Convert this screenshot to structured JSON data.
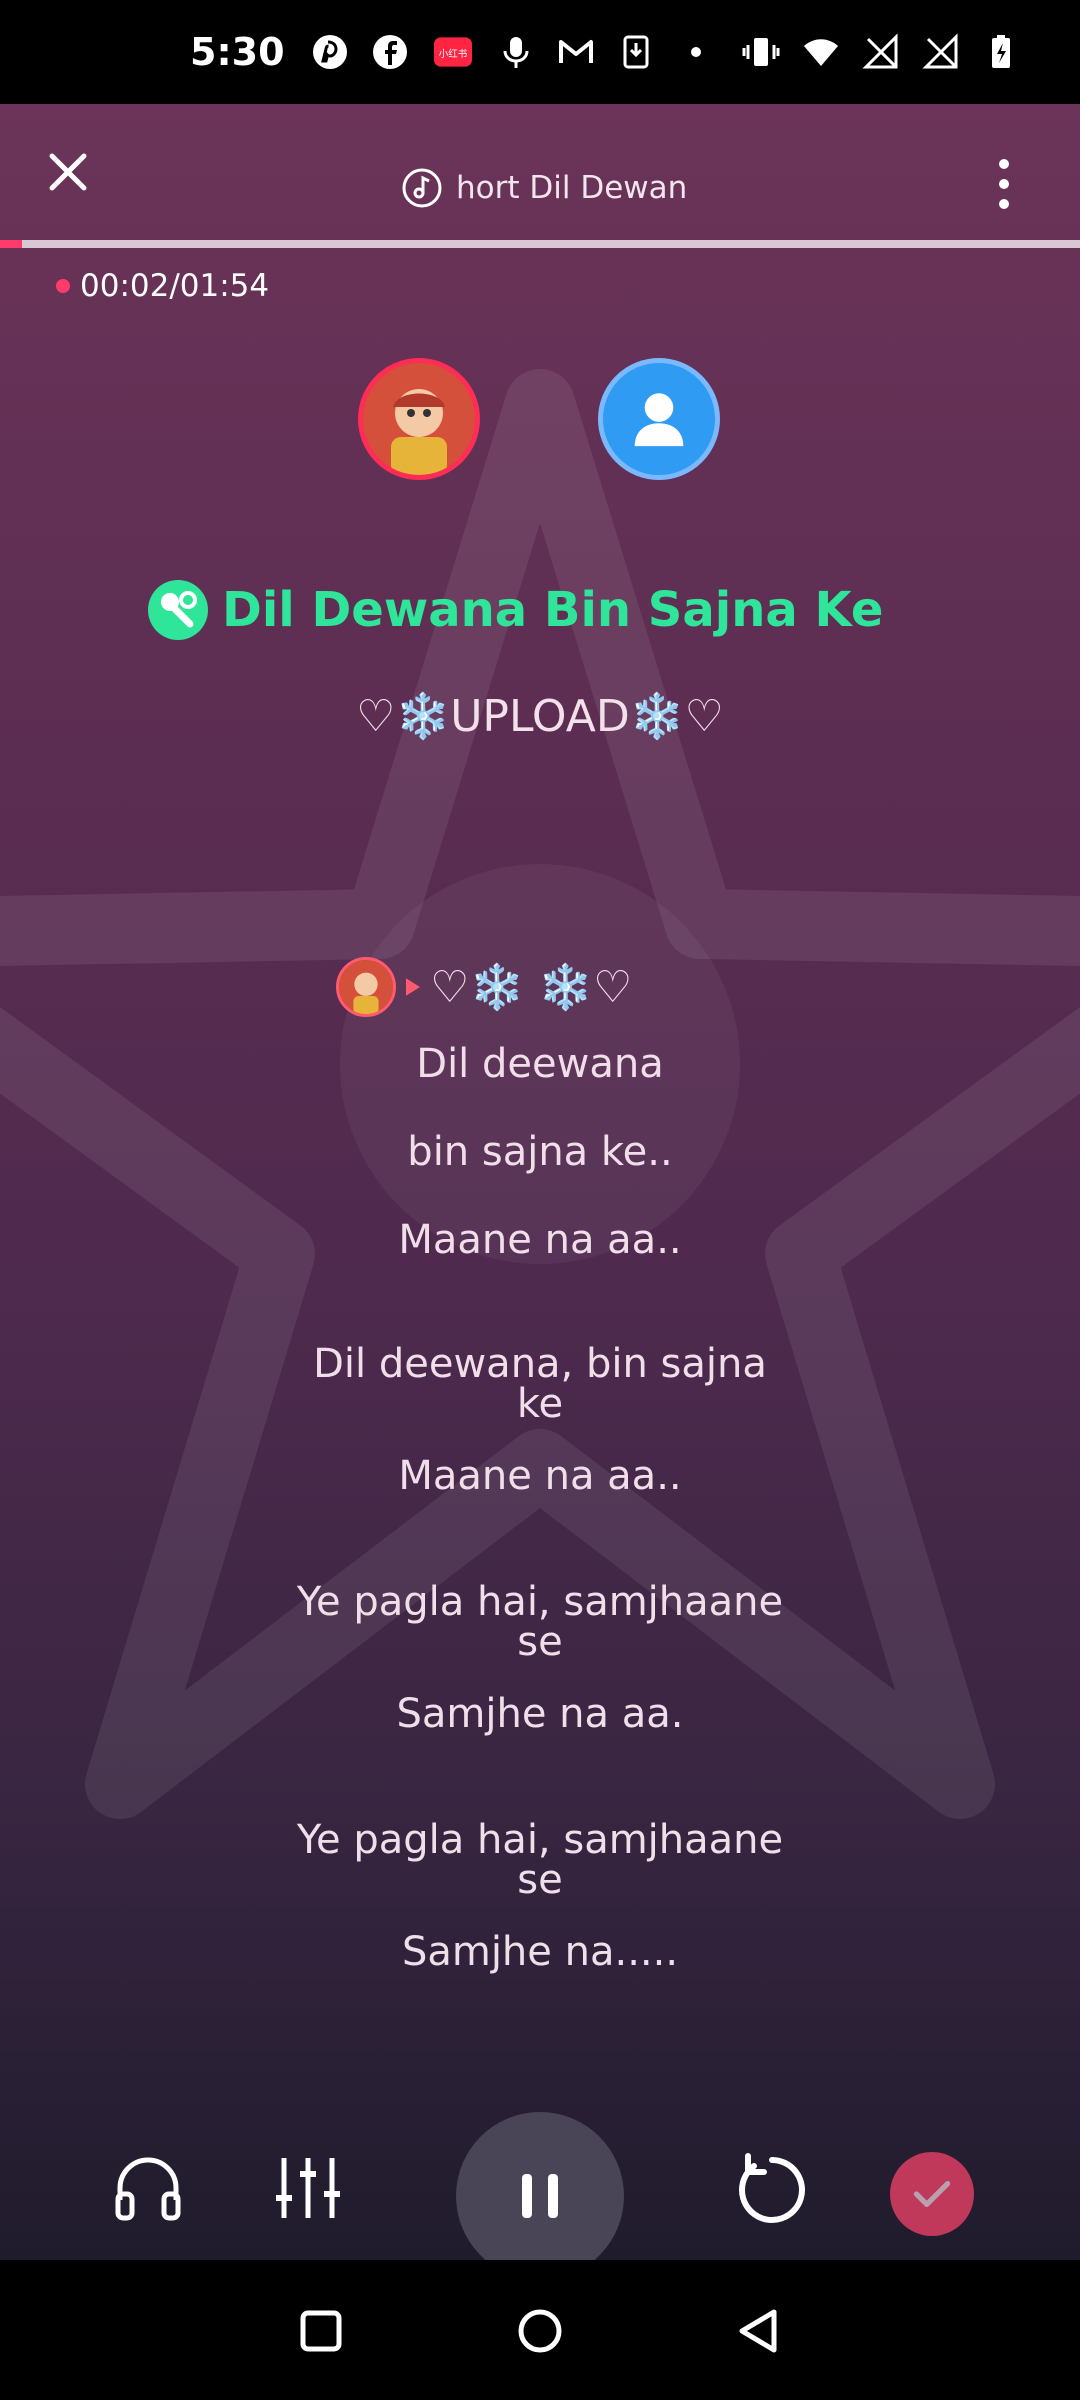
{
  "status_bar": {
    "time": "5:30",
    "left_icons": [
      "pinterest-icon",
      "facebook-icon",
      "app-badge-icon",
      "microphone-icon",
      "gmail-icon",
      "download-icon",
      "dot-icon"
    ],
    "right_icons": [
      "vibrate-icon",
      "wifi-icon",
      "signal-icon",
      "signal-icon",
      "battery-charging-icon"
    ],
    "app_badge_text": "小红书"
  },
  "header": {
    "title": "hort Dil Dewan"
  },
  "recording": {
    "progress": 0.02,
    "timer": "00:02/01:54"
  },
  "song": {
    "title": "Dil Dewana Bin Sajna Ke",
    "upload_label": "♡❄️UPLOAD❄️♡",
    "singer_tag": "♡❄️ ❄️♡"
  },
  "lyrics": [
    "Dil deewana",
    "bin sajna ke..",
    "Maane na aa..",
    "Dil deewana, bin sajna\nke",
    "Maane na aa..",
    "Ye pagla hai, samjhaane\nse",
    "Samjhe na aa.",
    "Ye pagla hai, samjhaane\nse",
    "Samjhe na....."
  ],
  "colors": {
    "accent": "#ff3b6b",
    "title_green": "#2ee59a",
    "done_button": "#c0395a",
    "avatar_blue": "#2f9bf2"
  },
  "controls": {
    "icons": [
      "headphone-icon",
      "mixer-icon",
      "pause-icon",
      "replay-icon",
      "check-icon"
    ]
  },
  "nav": {
    "icons": [
      "recents-square-icon",
      "home-circle-icon",
      "back-triangle-icon"
    ]
  }
}
